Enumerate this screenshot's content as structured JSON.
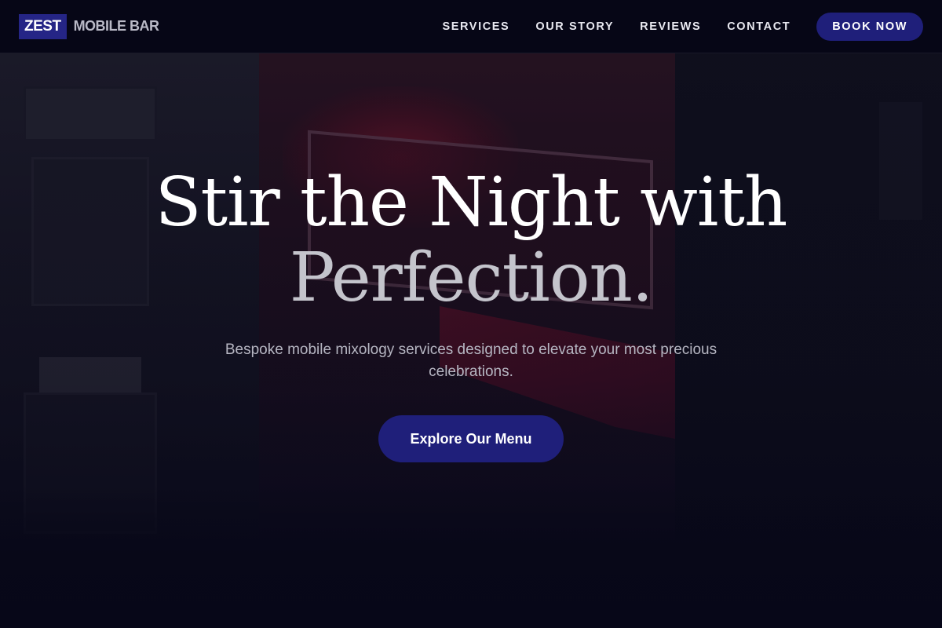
{
  "brand": {
    "mark": "ZEST",
    "name": "MOBILE BAR"
  },
  "nav": {
    "links": [
      {
        "label": "SERVICES"
      },
      {
        "label": "OUR STORY"
      },
      {
        "label": "REVIEWS"
      },
      {
        "label": "CONTACT"
      }
    ],
    "cta_label": "BOOK NOW"
  },
  "hero": {
    "headline_line1": "Stir the Night with",
    "headline_line2": "Perfection.",
    "subtitle": "Bespoke mobile mixology services designed to elevate your most precious celebrations.",
    "cta_label": "Explore Our Menu"
  },
  "colors": {
    "brand_accent": "#1f1f7a",
    "page_background": "#07071a",
    "headline_primary": "#ffffff",
    "headline_secondary": "#c4c4cc"
  }
}
